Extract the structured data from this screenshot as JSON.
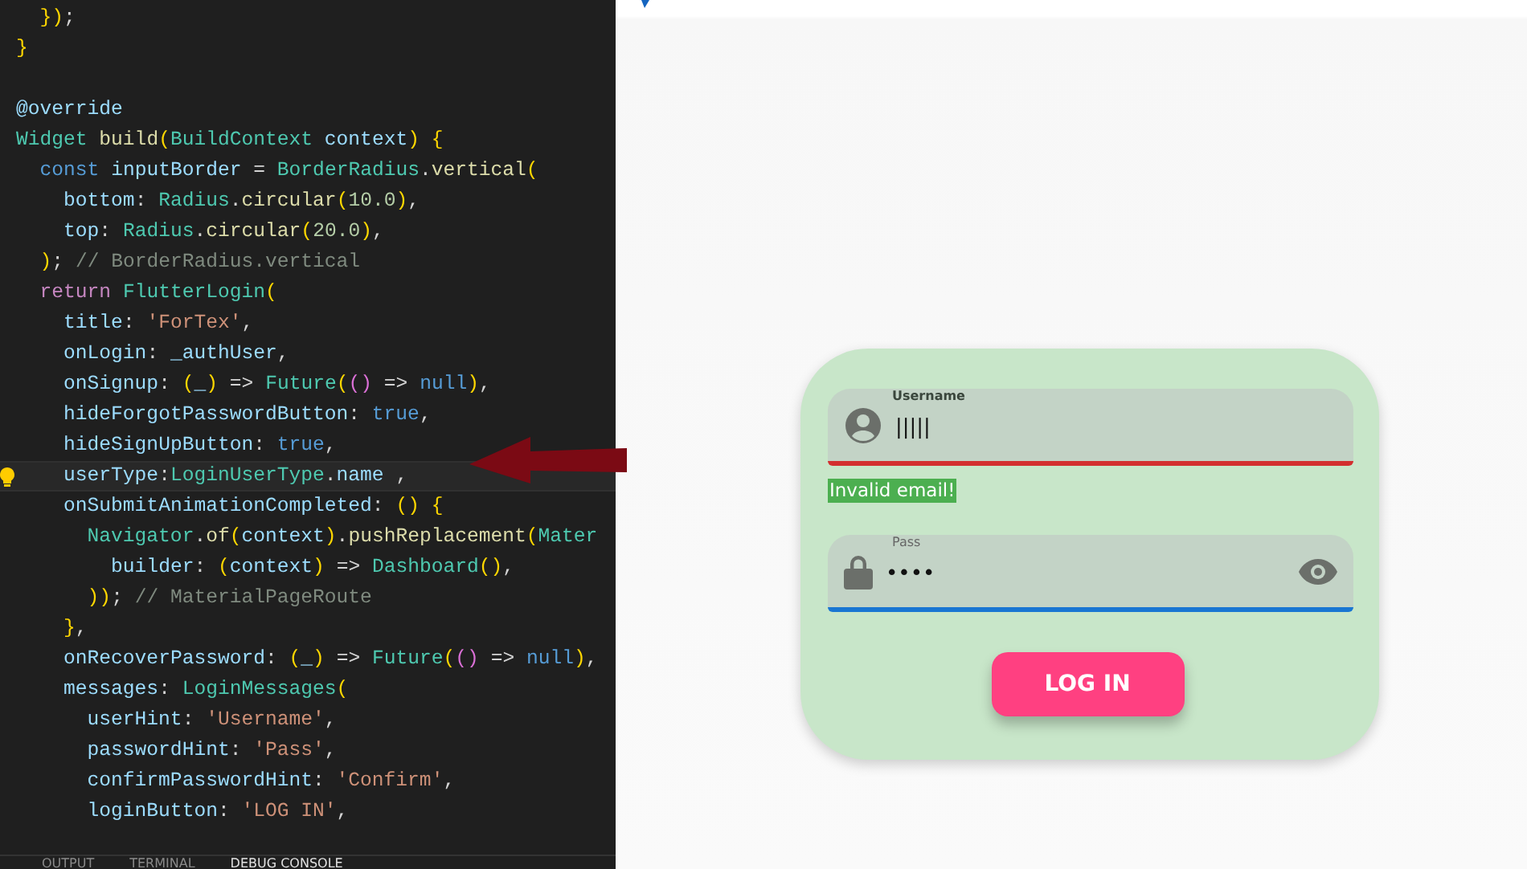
{
  "editor": {
    "lines": [
      {
        "text": "  });",
        "current": false
      },
      {
        "text": "}",
        "current": false
      },
      {
        "current": false
      },
      {
        "text": "@override",
        "current": false
      },
      {
        "text": "Widget build(BuildContext context) {",
        "current": false
      },
      {
        "text": "  const inputBorder = BorderRadius.vertical(",
        "current": false
      },
      {
        "text": "    bottom: Radius.circular(10.0),",
        "current": false
      },
      {
        "text": "    top: Radius.circular(20.0),",
        "current": false
      },
      {
        "text": "  ); // BorderRadius.vertical",
        "current": false
      },
      {
        "text": "  return FlutterLogin(",
        "current": false
      },
      {
        "text": "    title: 'ForTex',",
        "current": false
      },
      {
        "text": "    onLogin: _authUser,",
        "current": false
      },
      {
        "text": "    onSignup: (_) => Future(() => null),",
        "current": false
      },
      {
        "text": "    hideForgotPasswordButton: true,",
        "current": false
      },
      {
        "text": "    hideSignUpButton: true,",
        "current": false
      },
      {
        "text": "    userType:LoginUserType.name ,",
        "current": true
      },
      {
        "text": "    onSubmitAnimationCompleted: () {",
        "current": false
      },
      {
        "text": "      Navigator.of(context).pushReplacement(Mater",
        "current": false
      },
      {
        "text": "        builder: (context) => Dashboard(),",
        "current": false
      },
      {
        "text": "      )); // MaterialPageRoute",
        "current": false
      },
      {
        "text": "    },",
        "current": false
      },
      {
        "text": "    onRecoverPassword: (_) => Future(() => null),",
        "current": false
      },
      {
        "text": "    messages: LoginMessages(",
        "current": false
      },
      {
        "text": "      userHint: 'Username',",
        "current": false
      },
      {
        "text": "      passwordHint: 'Pass',",
        "current": false
      },
      {
        "text": "      confirmPasswordHint: 'Confirm',",
        "current": false
      },
      {
        "text": "      loginButton: 'LOG IN',",
        "current": false
      }
    ],
    "panel_tabs": [
      {
        "label": "OUTPUT",
        "selected": false
      },
      {
        "label": "TERMINAL",
        "selected": false
      },
      {
        "label": "DEBUG CONSOLE",
        "selected": true
      }
    ]
  },
  "login": {
    "username": {
      "label": "Username",
      "value": "|||||",
      "error": true
    },
    "error_message": "Invalid email!",
    "password": {
      "label": "Pass",
      "value": "••••",
      "error": false
    },
    "button": "LOG IN"
  }
}
